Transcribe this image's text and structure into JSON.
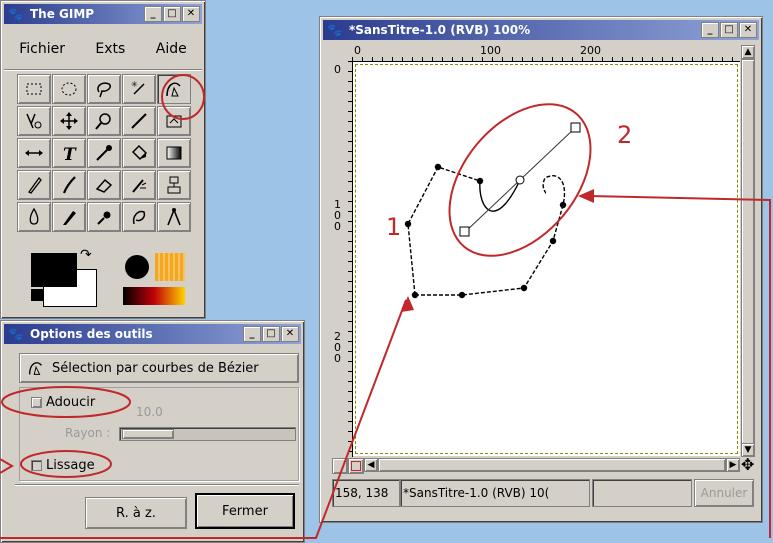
{
  "toolbox": {
    "title": "The GIMP",
    "menu": [
      "Fichier",
      "Exts",
      "Aide"
    ]
  },
  "tool_options": {
    "title": "Options des outils",
    "tool_name": "Sélection par courbes de Bézier",
    "adoucir_label": "Adoucir",
    "radius_value": "10.0",
    "radius_label": "Rayon :",
    "lissage_label": "Lissage",
    "reset_label": "R. à z.",
    "close_label": "Fermer"
  },
  "image_window": {
    "title": "*SansTitre-1.0 (RVB) 100%",
    "ruler_h": [
      "0",
      "100",
      "200"
    ],
    "ruler_v": [
      "0",
      "1 0 0",
      "2 0 0"
    ],
    "coords": "158, 138",
    "status_text": "*SansTitre-1.0 (RVB) 10(",
    "cancel_label": "Annuler"
  },
  "annotations": {
    "label_1": "1",
    "label_2": "2"
  },
  "colors": {
    "annotation": "#c0282a",
    "titlebar": "#2b3c8f",
    "window_bg": "#d4d0c8",
    "desktop": "#9dc3e6"
  }
}
